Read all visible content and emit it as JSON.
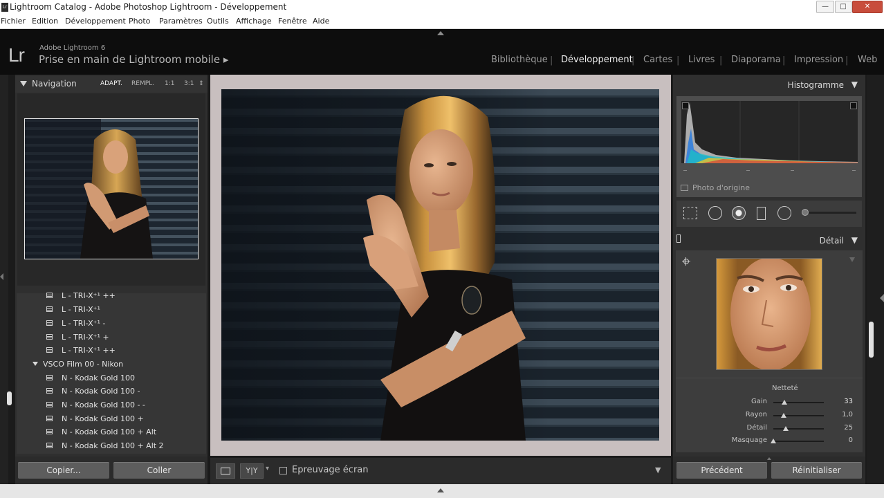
{
  "window": {
    "title": "Lightroom Catalog - Adobe Photoshop Lightroom - Développement",
    "icon": "lr-app-icon",
    "minimize_glyph": "—",
    "maximize_glyph": "□",
    "close_glyph": "✕"
  },
  "menu": [
    "Fichier",
    "Edition",
    "Développement",
    "Photo",
    "Paramètres",
    "Outils",
    "Affichage",
    "Fenêtre",
    "Aide"
  ],
  "identity": {
    "logo": "Lr",
    "version": "Adobe Lightroom 6",
    "mobile_link": "Prise en main de Lightroom mobile ▸"
  },
  "modules": [
    {
      "label": "Bibliothèque",
      "active": false
    },
    {
      "label": "Développement",
      "active": true
    },
    {
      "label": "Cartes",
      "active": false
    },
    {
      "label": "Livres",
      "active": false
    },
    {
      "label": "Diaporama",
      "active": false
    },
    {
      "label": "Impression",
      "active": false
    },
    {
      "label": "Web",
      "active": false
    }
  ],
  "module_separator": "|",
  "navigator": {
    "title": "Navigation",
    "zoom_options": [
      "ADAPT.",
      "REMPL.",
      "1:1",
      "3:1"
    ],
    "zoom_selected": "ADAPT.",
    "zoom_spinner": "⇕"
  },
  "presets": [
    {
      "label": "L - TRI-X⁺¹ ++",
      "type": "preset"
    },
    {
      "label": "L - TRI-X⁺¹",
      "type": "preset"
    },
    {
      "label": "L - TRI-X⁺¹ -",
      "type": "preset"
    },
    {
      "label": "L - TRI-X⁺¹ +",
      "type": "preset"
    },
    {
      "label": "L - TRI-X⁺¹ ++",
      "type": "preset"
    },
    {
      "label": "VSCO Film 00 - Nikon",
      "type": "folder"
    },
    {
      "label": "N - Kodak Gold 100",
      "type": "preset"
    },
    {
      "label": "N - Kodak Gold 100 -",
      "type": "preset"
    },
    {
      "label": "N - Kodak Gold 100 - -",
      "type": "preset"
    },
    {
      "label": "N - Kodak Gold 100 +",
      "type": "preset"
    },
    {
      "label": "N - Kodak Gold 100 + Alt",
      "type": "preset"
    },
    {
      "label": "N - Kodak Gold 100 + Alt 2",
      "type": "preset"
    }
  ],
  "left_buttons": {
    "copy": "Copier...",
    "paste": "Coller"
  },
  "toolbar": {
    "view_loupe": "loupe-view-icon",
    "view_compare": "Y|Y",
    "dropdown_arrow": "▾",
    "softproof_label": "Epreuvage écran",
    "softproof_checked": false,
    "menu_arrow": "▼"
  },
  "histogram": {
    "title": "Histogramme",
    "original_photo_label": "Photo d'origine",
    "original_photo_checked": false,
    "clip_shadow_icon": "shadow-clipping-icon",
    "clip_highlight_icon": "highlight-clipping-icon"
  },
  "tools": [
    "crop-overlay-icon",
    "spot-removal-icon",
    "red-eye-icon",
    "graduated-filter-icon",
    "radial-filter-icon",
    "adjustment-brush-icon"
  ],
  "detail": {
    "title": "Détail",
    "section": "Netteté",
    "sliders": [
      {
        "label": "Gain",
        "value": "33",
        "fraction": 0.22
      },
      {
        "label": "Rayon",
        "value": "1,0",
        "fraction": 0.2
      },
      {
        "label": "Détail",
        "value": "25",
        "fraction": 0.25
      },
      {
        "label": "Masquage",
        "value": "0",
        "fraction": 0.0
      }
    ]
  },
  "right_buttons": {
    "previous": "Précédent",
    "reset": "Réinitialiser"
  },
  "panel_arrows": {
    "collapse": "▼",
    "expand": "◀"
  }
}
